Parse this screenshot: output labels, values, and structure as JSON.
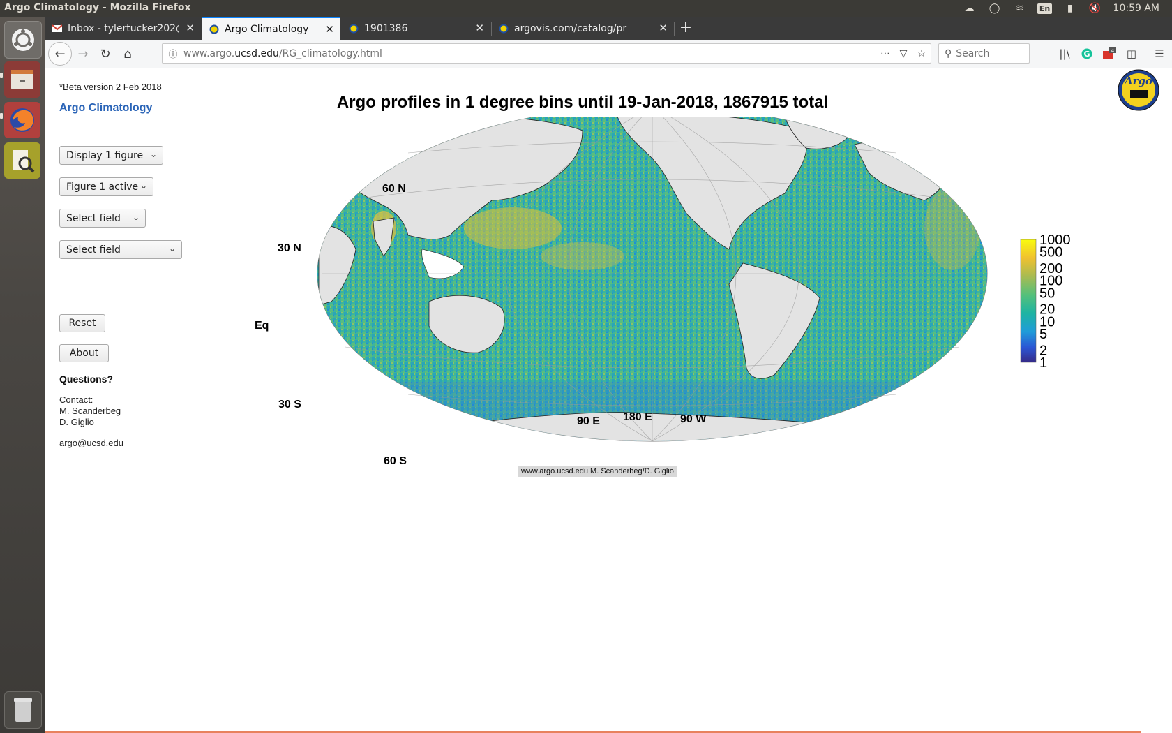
{
  "os": {
    "window_title": "Argo Climatology - Mozilla Firefox",
    "clock": "10:59 AM",
    "keyboard_layout": "En"
  },
  "browser": {
    "tabs": [
      {
        "label": "Inbox - tylertucker202@",
        "icon": "gmail-icon",
        "active": false
      },
      {
        "label": "Argo Climatology",
        "icon": "argo-favicon",
        "active": true
      },
      {
        "label": "1901386",
        "icon": "argo-favicon",
        "active": false
      },
      {
        "label": "argovis.com/catalog/pr",
        "icon": "argo-favicon",
        "active": false
      }
    ],
    "url_prefix": "www.argo.",
    "url_domain": "ucsd.edu",
    "url_path": "/RG_climatology.html",
    "search_placeholder": "Search",
    "notification_count": "4"
  },
  "page": {
    "beta_note": "*Beta version 2 Feb 2018",
    "site_title": "Argo Climatology",
    "controls": {
      "display_select": "Display 1 figure",
      "figure_select": "Figure 1 active",
      "field_select_1": "Select field",
      "field_select_2": "Select field",
      "reset_label": "Reset",
      "about_label": "About"
    },
    "questions_heading": "Questions?",
    "contact_label": "Contact:",
    "contact_names": [
      "M. Scanderbeg",
      "D. Giglio"
    ],
    "email": "argo@ucsd.edu",
    "logo_text": "Argo"
  },
  "chart_data": {
    "type": "heatmap",
    "title": "Argo profiles in 1 degree bins until 19-Jan-2018, 1867915 total",
    "projection": "Hammer-Aitoff, Pacific-centred",
    "lat_labels": [
      "60 N",
      "30 N",
      "Eq",
      "30 S",
      "60 S"
    ],
    "lon_labels": [
      "90 E",
      "180 E",
      "90 W"
    ],
    "colorbar": {
      "scale": "log",
      "ticks": [
        "1000",
        "500",
        "200",
        "100",
        "50",
        "20",
        "10",
        "5",
        "2",
        "1"
      ],
      "colors": [
        "#f9fb0e",
        "#f0c12f",
        "#d3ae3e",
        "#a8bb52",
        "#55c07a",
        "#1eb4a2",
        "#1f9cd9",
        "#1a7fe6",
        "#2b55d4",
        "#352a87"
      ],
      "range": [
        1,
        1000
      ]
    },
    "credit": "www.argo.ucsd.edu M. Scanderbeg/D. Giglio"
  }
}
